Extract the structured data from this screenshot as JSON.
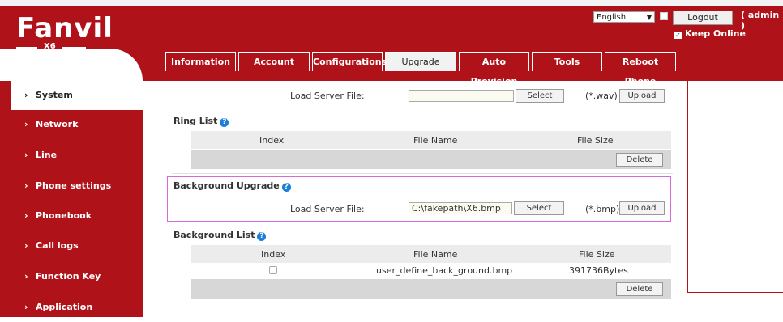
{
  "header": {
    "logo_text": "Fanvil",
    "logo_model": "X6",
    "language": "English",
    "logout_label": "Logout",
    "user_label": "( admin )",
    "keep_online_label": "Keep Online"
  },
  "tabs": [
    {
      "label": "Information"
    },
    {
      "label": "Account"
    },
    {
      "label": "Configurations"
    },
    {
      "label": "Upgrade"
    },
    {
      "label": "Auto Provision"
    },
    {
      "label": "Tools"
    },
    {
      "label": "Reboot Phone"
    }
  ],
  "sidebar": {
    "items": [
      {
        "label": "System"
      },
      {
        "label": "Network"
      },
      {
        "label": "Line"
      },
      {
        "label": "Phone settings"
      },
      {
        "label": "Phonebook"
      },
      {
        "label": "Call logs"
      },
      {
        "label": "Function Key"
      },
      {
        "label": "Application"
      }
    ]
  },
  "ring_upgrade": {
    "load_label": "Load Server File:",
    "file_value": "",
    "select_label": "Select",
    "ext_label": "(*.wav)",
    "upload_label": "Upload"
  },
  "ring_list": {
    "title": "Ring List",
    "columns": [
      "Index",
      "File Name",
      "File Size"
    ],
    "delete_label": "Delete"
  },
  "background_upgrade": {
    "title": "Background Upgrade",
    "load_label": "Load Server File:",
    "file_value": "C:\\fakepath\\X6.bmp",
    "select_label": "Select",
    "ext_label": "(*.bmp)",
    "upload_label": "Upload"
  },
  "background_list": {
    "title": "Background List",
    "columns": [
      "Index",
      "File Name",
      "File Size"
    ],
    "rows": [
      {
        "file_name": "user_define_back_ground.bmp",
        "file_size": "391736Bytes"
      }
    ],
    "delete_label": "Delete"
  },
  "colors": {
    "brand_red": "#b0121a",
    "help_blue": "#1a7fd6",
    "highlight_border": "#d86ad8"
  }
}
